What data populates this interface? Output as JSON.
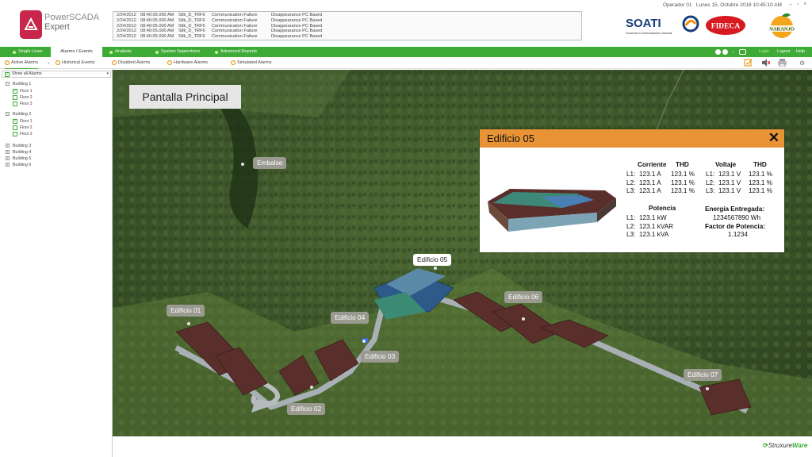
{
  "app": {
    "logo_line1": "PowerSCADA",
    "logo_line2": "Expert"
  },
  "header": {
    "operator": "Operador 01",
    "datetime": "Lunes 15, Octubre 2018  10:45:10 AM",
    "window_controls": "– ▫ ×",
    "alarms": [
      {
        "date": "2/24/2012",
        "time": "08:40:05.000 AM",
        "source": "Stlk_D_TRF6",
        "type": "Communication Failure",
        "desc": "Disappearance PC Based"
      },
      {
        "date": "2/24/2012",
        "time": "08:40:05.000 AM",
        "source": "Stlk_D_TRF6",
        "type": "Communication Failure",
        "desc": "Disappearance PC Based"
      },
      {
        "date": "2/24/2012",
        "time": "08:40:05.000 AM",
        "source": "Stlk_D_TRF6",
        "type": "Communication Failure",
        "desc": "Disappearance PC Based"
      },
      {
        "date": "2/24/2012",
        "time": "08:40:05.000 AM",
        "source": "Stlk_D_TRF6",
        "type": "Communication Failure",
        "desc": "Disappearance PC Based"
      },
      {
        "date": "2/24/2012",
        "time": "08:40:05.000 AM",
        "source": "Stlk_D_TRF6",
        "type": "Communication Failure",
        "desc": "Disappearance PC Based"
      }
    ],
    "logos": {
      "soati": "SOATI",
      "soati_sub": "Soluciones en Automatización Industrial",
      "fideca": "FIDECA",
      "naranjo": "NARANJO"
    }
  },
  "nav": {
    "items": [
      "Single Lines",
      "Alarms / Events",
      "Analysis",
      "System Supervision",
      "Advanced Reports"
    ],
    "login": "Login",
    "logout": "Logout",
    "help": "Help"
  },
  "subnav": {
    "items": [
      "Active Alarms",
      "Historical Events",
      "Disabled Alarms",
      "Hardware Alarms",
      "Simulated Alarms"
    ]
  },
  "tree": {
    "show_all": "Show all Alarms",
    "buildings": [
      {
        "label": "Building 1",
        "floors": [
          "Floor 1",
          "Floor 2",
          "Floor 3"
        ]
      },
      {
        "label": "Building 2",
        "floors": [
          "Floor 1",
          "Floor 2",
          "Floor 3"
        ]
      },
      {
        "label": "Building 3"
      },
      {
        "label": "Building 4"
      },
      {
        "label": "Building 5"
      },
      {
        "label": "Building 6"
      }
    ]
  },
  "map": {
    "title": "Pantalla Principal",
    "labels": [
      "Embalse",
      "Edificio 01",
      "Edificio 02",
      "Edificio 03",
      "Edificio 04",
      "Edificio 05",
      "Edificio 06",
      "Edificio 07"
    ]
  },
  "panel": {
    "title": "Edificio 05",
    "close": "✕",
    "corriente": "Corriente",
    "thd": "THD",
    "voltaje": "Voltaje",
    "currents": [
      {
        "phase": "L1:",
        "value": "123.1 A",
        "thd": "123.1 %"
      },
      {
        "phase": "L2:",
        "value": "123.1 A",
        "thd": "123.1 %"
      },
      {
        "phase": "L3:",
        "value": "123.1 A",
        "thd": "123.1 %"
      }
    ],
    "voltages": [
      {
        "phase": "L1:",
        "value": "123.1 V",
        "thd": "123.1 %"
      },
      {
        "phase": "L2:",
        "value": "123.1 V",
        "thd": "123.1 %"
      },
      {
        "phase": "L3:",
        "value": "123.1 V",
        "thd": "123.1 %"
      }
    ],
    "potencia": "Potencia",
    "powers": [
      {
        "phase": "L1:",
        "value": "123.1 kW"
      },
      {
        "phase": "L2:",
        "value": "123.1 kVAR"
      },
      {
        "phase": "L3:",
        "value": "123.1 kVA"
      }
    ],
    "energia_label": "Energía Entregada:",
    "energia_value": "1234567890 Wh",
    "factor_label": "Factor de Potencia:",
    "factor_value": "1.1234"
  },
  "footer": {
    "brand_prefix": "Struxure",
    "brand_suffix": "Ware"
  },
  "colors": {
    "nav_green": "#3dab35",
    "panel_orange": "#e89335",
    "brand_red": "#c8264a"
  }
}
